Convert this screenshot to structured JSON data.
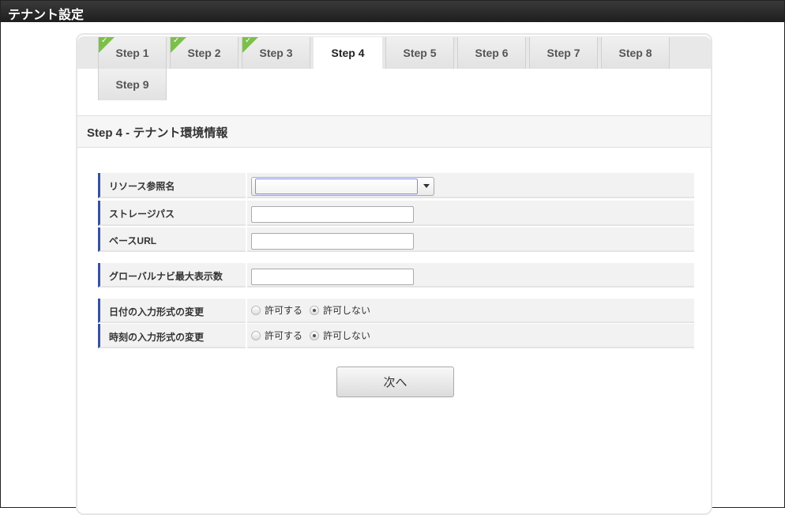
{
  "window": {
    "title": "テナント設定"
  },
  "tabs": [
    {
      "label": "Step 1",
      "done": true
    },
    {
      "label": "Step 2",
      "done": true
    },
    {
      "label": "Step 3",
      "done": true
    },
    {
      "label": "Step 4",
      "active": true
    },
    {
      "label": "Step 5"
    },
    {
      "label": "Step 6"
    },
    {
      "label": "Step 7"
    },
    {
      "label": "Step 8"
    },
    {
      "label": "Step 9"
    }
  ],
  "section": {
    "title": "Step 4 - テナント環境情報"
  },
  "form": {
    "resource_ref": {
      "label": "リソース参照名",
      "value": ""
    },
    "storage_path": {
      "label": "ストレージパス",
      "value": ""
    },
    "base_url": {
      "label": "ベースURL",
      "value": ""
    },
    "global_nav_max": {
      "label": "グローバルナビ最大表示数",
      "value": ""
    },
    "date_format_change": {
      "label": "日付の入力形式の変更",
      "options": [
        "許可する",
        "許可しない"
      ],
      "selected": "許可しない"
    },
    "time_format_change": {
      "label": "時刻の入力形式の変更",
      "options": [
        "許可する",
        "許可しない"
      ],
      "selected": "許可しない"
    }
  },
  "buttons": {
    "next": "次へ"
  },
  "check_glyph": "✓"
}
